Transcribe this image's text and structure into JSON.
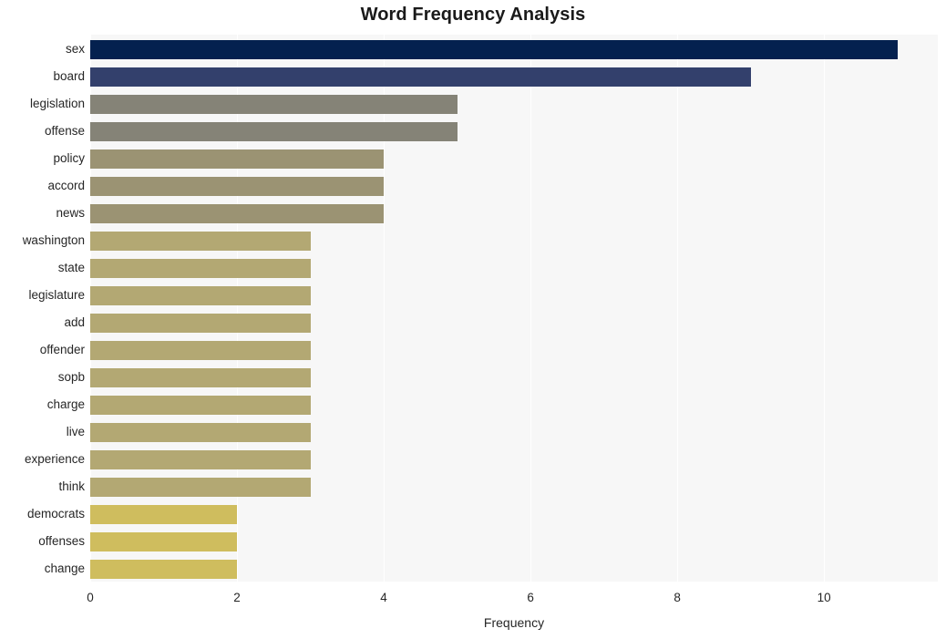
{
  "chart_data": {
    "type": "bar",
    "orientation": "horizontal",
    "title": "Word Frequency Analysis",
    "xlabel": "Frequency",
    "ylabel": "",
    "xlim": [
      0,
      11.55
    ],
    "ylim": [
      0,
      20
    ],
    "grid": "vertical-white-on-light-gray",
    "legend": "none",
    "x_ticks": [
      "0",
      "2",
      "4",
      "6",
      "8",
      "10"
    ],
    "x_tick_values": [
      0,
      2,
      4,
      6,
      8,
      10
    ],
    "categories": [
      "sex",
      "board",
      "legislation",
      "offense",
      "policy",
      "accord",
      "news",
      "washington",
      "state",
      "legislature",
      "add",
      "offender",
      "sopb",
      "charge",
      "live",
      "experience",
      "think",
      "democrats",
      "offenses",
      "change"
    ],
    "values": [
      11,
      9,
      5,
      5,
      4,
      4,
      4,
      3,
      3,
      3,
      3,
      3,
      3,
      3,
      3,
      3,
      3,
      2,
      2,
      2
    ],
    "bar_colors": [
      "#04214f",
      "#33406c",
      "#858377",
      "#858377",
      "#9b9373",
      "#9b9373",
      "#9b9373",
      "#b3a873",
      "#b3a873",
      "#b3a873",
      "#b3a873",
      "#b3a873",
      "#b3a873",
      "#b3a873",
      "#b3a873",
      "#b3a873",
      "#b3a873",
      "#cfbd5e",
      "#cfbd5e",
      "#cfbd5e"
    ],
    "plot_background": "#f7f7f7",
    "page_background": "#ffffff"
  }
}
